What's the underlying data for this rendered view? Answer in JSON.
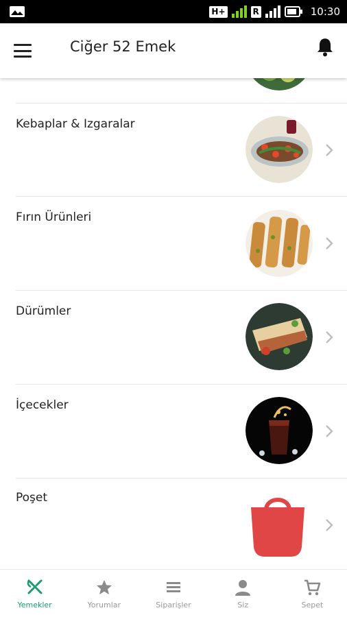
{
  "status_bar": {
    "network_badge_1": "H+",
    "network_badge_2": "R",
    "time": "10:30"
  },
  "app_bar": {
    "title": "Ciğer 52 Emek",
    "menu_icon": "hamburger-menu-icon",
    "notification_icon": "bell-icon"
  },
  "categories": [
    {
      "label": "Kebaplar & Izgaralar",
      "image": "kebab-plate"
    },
    {
      "label": "Fırın Ürünleri",
      "image": "pide-bread"
    },
    {
      "label": "Dürümler",
      "image": "durum-wrap"
    },
    {
      "label": "İçecekler",
      "image": "cola-drink"
    },
    {
      "label": "Poşet",
      "image": "red-bag"
    }
  ],
  "bottom_nav": {
    "items": [
      {
        "label": "Yemekler",
        "icon": "fork-knife-icon",
        "active": true
      },
      {
        "label": "Yorumlar",
        "icon": "star-icon",
        "active": false
      },
      {
        "label": "Siparişler",
        "icon": "list-icon",
        "active": false
      },
      {
        "label": "Siz",
        "icon": "person-icon",
        "active": false
      },
      {
        "label": "Sepet",
        "icon": "cart-icon",
        "active": false
      }
    ]
  },
  "colors": {
    "accent": "#1a9a6e",
    "inactive": "#9a9a9a",
    "bag": "#e04646"
  }
}
